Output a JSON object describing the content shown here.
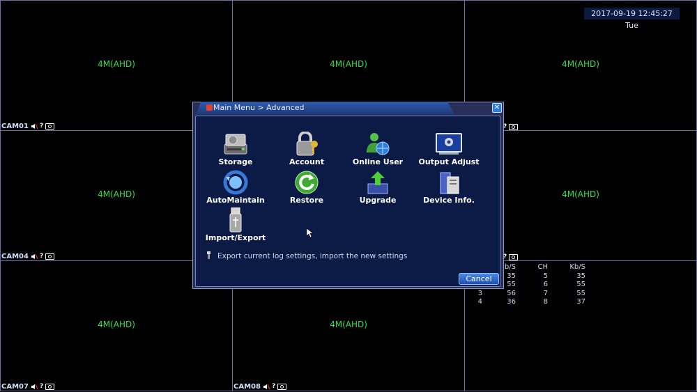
{
  "datetime": "2017-09-19 12:45:27 Tue",
  "channels": [
    {
      "label": "CAM01",
      "res": "4M(AHD)"
    },
    {
      "label": "",
      "res": "4M(AHD)"
    },
    {
      "label": "",
      "res": "4M(AHD)"
    },
    {
      "label": "CAM04",
      "res": "4M(AHD)"
    },
    {
      "label": "",
      "res": ""
    },
    {
      "label": "",
      "res": "4M(AHD)"
    },
    {
      "label": "CAM07",
      "res": "4M(AHD)"
    },
    {
      "label": "CAM08",
      "res": "4M(AHD)"
    },
    {
      "label": "",
      "res": ""
    }
  ],
  "stats": {
    "headers": [
      "",
      "b/S",
      "CH",
      "Kb/S"
    ],
    "rows": [
      [
        "",
        "35",
        "5",
        "35"
      ],
      [
        "",
        "55",
        "6",
        "55"
      ],
      [
        "3",
        "56",
        "7",
        "55"
      ],
      [
        "4",
        "36",
        "8",
        "37"
      ]
    ]
  },
  "dialog": {
    "title": "Main Menu > Advanced",
    "items": [
      {
        "label": "Storage",
        "icon": "storage-icon"
      },
      {
        "label": "Account",
        "icon": "lock-icon"
      },
      {
        "label": "Online User",
        "icon": "online-user-icon"
      },
      {
        "label": "Output Adjust",
        "icon": "monitor-gear-icon"
      },
      {
        "label": "AutoMaintain",
        "icon": "auto-maintain-icon"
      },
      {
        "label": "Restore",
        "icon": "restore-icon"
      },
      {
        "label": "Upgrade",
        "icon": "upgrade-icon"
      },
      {
        "label": "Device Info.",
        "icon": "device-info-icon"
      },
      {
        "label": "Import/Export",
        "icon": "usb-icon"
      }
    ],
    "hint": "Export current log settings, import the new settings",
    "cancel": "Cancel"
  },
  "colors": {
    "grid": "#6b6fa8",
    "res_text": "#33e04a",
    "dialog_body": "#0c1a46"
  }
}
